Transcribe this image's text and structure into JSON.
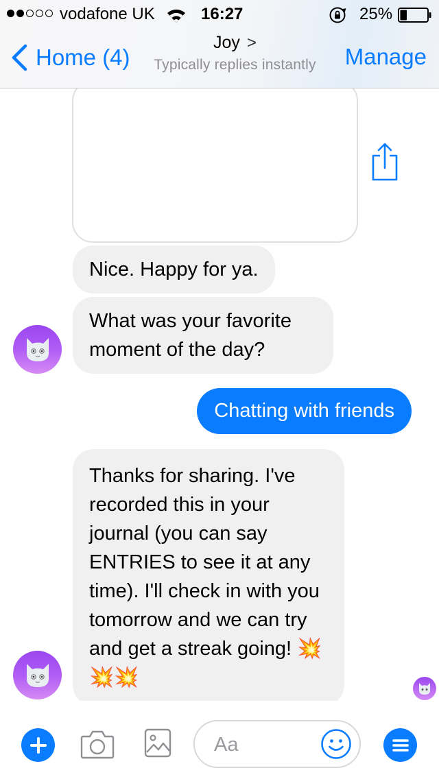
{
  "status_bar": {
    "carrier": "vodafone UK",
    "time": "16:27",
    "battery": "25%",
    "battery_level": 0.25,
    "signal_bars": 2,
    "signal_total": 5
  },
  "header": {
    "back_label": "Home (4)",
    "title": "Joy",
    "title_chevron": ">",
    "subtitle": "Typically replies instantly",
    "manage_label": "Manage"
  },
  "messages": {
    "m1": "Nice. Happy for ya.",
    "m2": "What was your favorite moment of the day?",
    "m3": "Chatting with friends",
    "m4": "Thanks for sharing. I've recorded this in your journal (you can say ENTRIES to see it at any time). I'll check in with you tomorrow and we can try and get a streak going! 💥💥💥"
  },
  "composer": {
    "placeholder": "Aa"
  },
  "colors": {
    "accent": "#0a7cff",
    "incoming_bubble": "#f0f0f0",
    "avatar": "#a653f2"
  },
  "icons": {
    "share": "share-icon",
    "plus": "plus-icon",
    "camera": "camera-icon",
    "gallery": "gallery-icon",
    "emoji": "smiley-icon",
    "menu": "menu-icon",
    "avatar": "cat-face-icon"
  }
}
